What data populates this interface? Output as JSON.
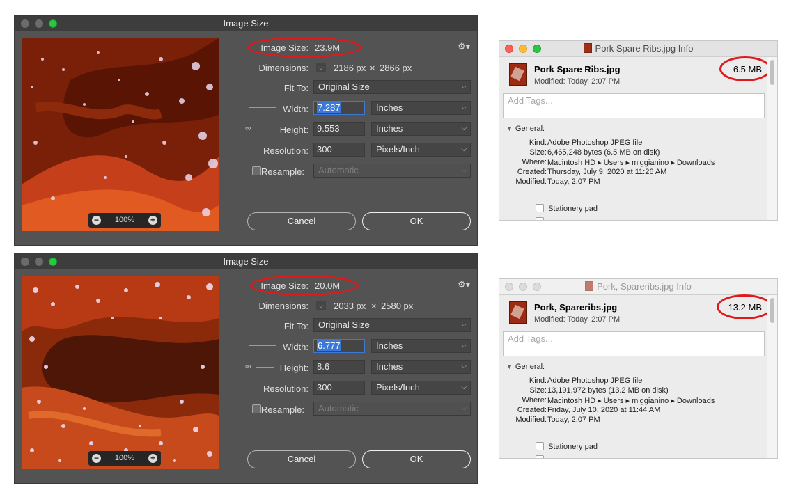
{
  "dialogs": [
    {
      "title": "Image Size",
      "image_size_label": "Image Size:",
      "image_size_value": "23.9M",
      "dimensions_label": "Dimensions:",
      "dim_w": "2186 px",
      "dim_x": "×",
      "dim_h": "2866 px",
      "fit_to_label": "Fit To:",
      "fit_to_value": "Original Size",
      "width_label": "Width:",
      "width_value": "7.287",
      "width_unit": "Inches",
      "height_label": "Height:",
      "height_value": "9.553",
      "height_unit": "Inches",
      "resolution_label": "Resolution:",
      "resolution_value": "300",
      "resolution_unit": "Pixels/Inch",
      "resample_label": "Resample:",
      "resample_value": "Automatic",
      "zoom": "100%",
      "cancel": "Cancel",
      "ok": "OK",
      "active": true
    },
    {
      "title": "Image Size",
      "image_size_label": "Image Size:",
      "image_size_value": "20.0M",
      "dimensions_label": "Dimensions:",
      "dim_w": "2033 px",
      "dim_x": "×",
      "dim_h": "2580 px",
      "fit_to_label": "Fit To:",
      "fit_to_value": "Original Size",
      "width_label": "Width:",
      "width_value": "6.777",
      "width_unit": "Inches",
      "height_label": "Height:",
      "height_value": "8.6",
      "height_unit": "Inches",
      "resolution_label": "Resolution:",
      "resolution_value": "300",
      "resolution_unit": "Pixels/Inch",
      "resample_label": "Resample:",
      "resample_value": "Automatic",
      "zoom": "100%",
      "cancel": "Cancel",
      "ok": "OK",
      "active": true
    }
  ],
  "info_windows": [
    {
      "title": "Pork Spare Ribs.jpg Info",
      "file_name": "Pork Spare Ribs.jpg",
      "modified_header": "Modified:  Today, 2:07 PM",
      "size_badge": "6.5 MB",
      "tags_placeholder": "Add Tags...",
      "general_label": "General:",
      "rows": [
        {
          "k": "Kind:",
          "v": "Adobe Photoshop JPEG file"
        },
        {
          "k": "Size:",
          "v": "6,465,248 bytes (6.5 MB on disk)"
        },
        {
          "k": "Where:",
          "v": "Macintosh HD ▸ Users ▸ miggianino ▸ Downloads"
        },
        {
          "k": "Created:",
          "v": "Thursday, July 9, 2020 at 11:26 AM"
        },
        {
          "k": "Modified:",
          "v": "Today, 2:07 PM"
        }
      ],
      "stationery_label": "Stationery pad",
      "active": true
    },
    {
      "title": "Pork, Spareribs.jpg Info",
      "file_name": "Pork, Spareribs.jpg",
      "modified_header": "Modified:  Today, 2:07 PM",
      "size_badge": "13.2 MB",
      "tags_placeholder": "Add Tags...",
      "general_label": "General:",
      "rows": [
        {
          "k": "Kind:",
          "v": "Adobe Photoshop JPEG file"
        },
        {
          "k": "Size:",
          "v": "13,191,972 bytes (13.2 MB on disk)"
        },
        {
          "k": "Where:",
          "v": "Macintosh HD ▸ Users ▸ miggianino ▸ Downloads"
        },
        {
          "k": "Created:",
          "v": "Friday, July 10, 2020 at 11:44 AM"
        },
        {
          "k": "Modified:",
          "v": "Today, 2:07 PM"
        }
      ],
      "stationery_label": "Stationery pad",
      "active": false
    }
  ],
  "colors": {
    "annotation_red": "#e0191c",
    "ps_panel": "#535353",
    "ps_titlebar": "#3d3d3d",
    "selection_blue": "#3b78d7",
    "meat_dark": "#6e1c06",
    "meat_orange": "#d2461a"
  },
  "icons": [
    "gear-icon",
    "chain-link-icon",
    "zoom-out-icon",
    "zoom-in-icon",
    "chevron-down-icon",
    "disclosure-triangle-icon",
    "jpeg-file-icon"
  ]
}
